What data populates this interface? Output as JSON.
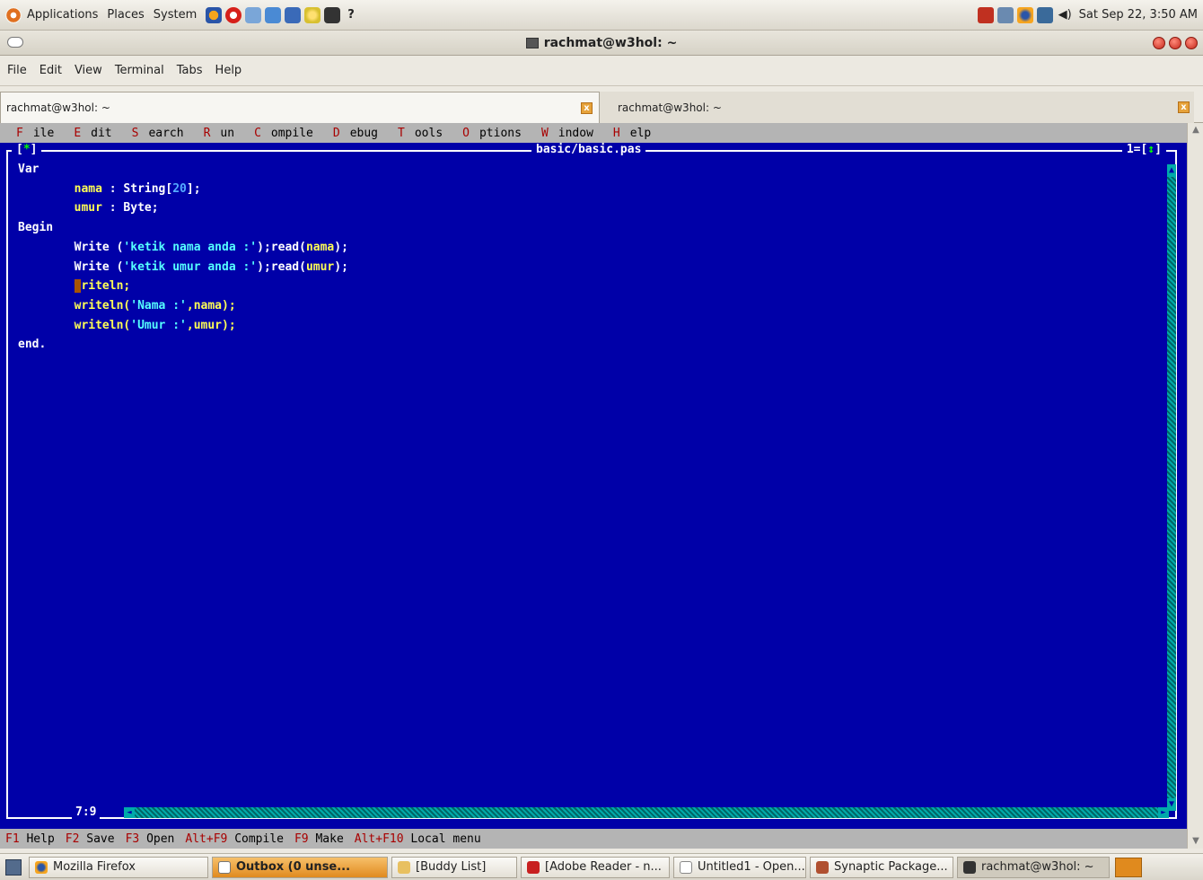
{
  "top_panel": {
    "menus": [
      "Applications",
      "Places",
      "System"
    ],
    "launcher_icons": [
      "firefox-icon",
      "opera-icon",
      "network-icon",
      "notes-icon",
      "shield-icon",
      "wifi-icon",
      "terminal-icon"
    ],
    "help_label": "?",
    "clock": "Sat Sep 22,  3:50 AM"
  },
  "window": {
    "title": "rachmat@w3hol: ~"
  },
  "terminal_menu": [
    "File",
    "Edit",
    "View",
    "Terminal",
    "Tabs",
    "Help"
  ],
  "tabs": [
    {
      "label": "rachmat@w3hol: ~"
    },
    {
      "label": "rachmat@w3hol: ~"
    }
  ],
  "ide": {
    "menu": [
      {
        "hot": "F",
        "rest": "ile"
      },
      {
        "hot": "E",
        "rest": "dit"
      },
      {
        "hot": "S",
        "rest": "earch"
      },
      {
        "hot": "R",
        "rest": "un"
      },
      {
        "hot": "C",
        "rest": "ompile"
      },
      {
        "hot": "D",
        "rest": "ebug"
      },
      {
        "hot": "T",
        "rest": "ools"
      },
      {
        "hot": "O",
        "rest": "ptions"
      },
      {
        "hot": "W",
        "rest": "indow"
      },
      {
        "hot": "H",
        "rest": "elp"
      }
    ],
    "close_box": "[",
    "close_star": "*",
    "close_end": "]",
    "filename": "basic/basic.pas",
    "window_number": "1=[",
    "zoom_glyph": "↕",
    "window_number_end": "]",
    "code": {
      "l1": "Var",
      "l2_id": "nama",
      "l2_mid": " : String[",
      "l2_num": "20",
      "l2_end": "];",
      "l3_id": "umur",
      "l3_mid": " : Byte;",
      "l4": "Begin",
      "l5_a": "Write (",
      "l5_str": "'ketik nama anda :'",
      "l5_b": ");read(",
      "l5_id": "nama",
      "l5_c": ");",
      "l6_a": "Write (",
      "l6_str": "'ketik umur anda :'",
      "l6_b": ");read(",
      "l6_id": "umur",
      "l6_c": ");",
      "l7_cursor": "w",
      "l7_rest": "riteln;",
      "l8_a": "writeln(",
      "l8_str": "'Nama :'",
      "l8_b": ",nama);",
      "l9_a": "writeln(",
      "l9_str": "'Umur :'",
      "l9_b": ",umur);",
      "l10": "end."
    },
    "cursor_pos": "7:9",
    "status": [
      {
        "key": "F1",
        "label": "Help"
      },
      {
        "key": "F2",
        "label": "Save"
      },
      {
        "key": "F3",
        "label": "Open"
      },
      {
        "key": "Alt+F9",
        "label": "Compile"
      },
      {
        "key": "F9",
        "label": "Make"
      },
      {
        "key": "Alt+F10",
        "label": "Local menu"
      }
    ]
  },
  "taskbar": [
    {
      "label": "Mozilla Firefox",
      "icon": "firefox-icon",
      "state": "normal"
    },
    {
      "label": "Outbox (0 unse...",
      "icon": "mail-icon",
      "state": "active"
    },
    {
      "label": "[Buddy List]",
      "icon": "pidgin-icon",
      "state": "normal"
    },
    {
      "label": "[Adobe Reader - n...",
      "icon": "adobe-reader-icon",
      "state": "normal"
    },
    {
      "label": "Untitled1 - Open...",
      "icon": "document-icon",
      "state": "normal"
    },
    {
      "label": "Synaptic Package...",
      "icon": "synaptic-icon",
      "state": "normal"
    },
    {
      "label": "rachmat@w3hol: ~",
      "icon": "terminal-icon",
      "state": "pressed"
    }
  ]
}
